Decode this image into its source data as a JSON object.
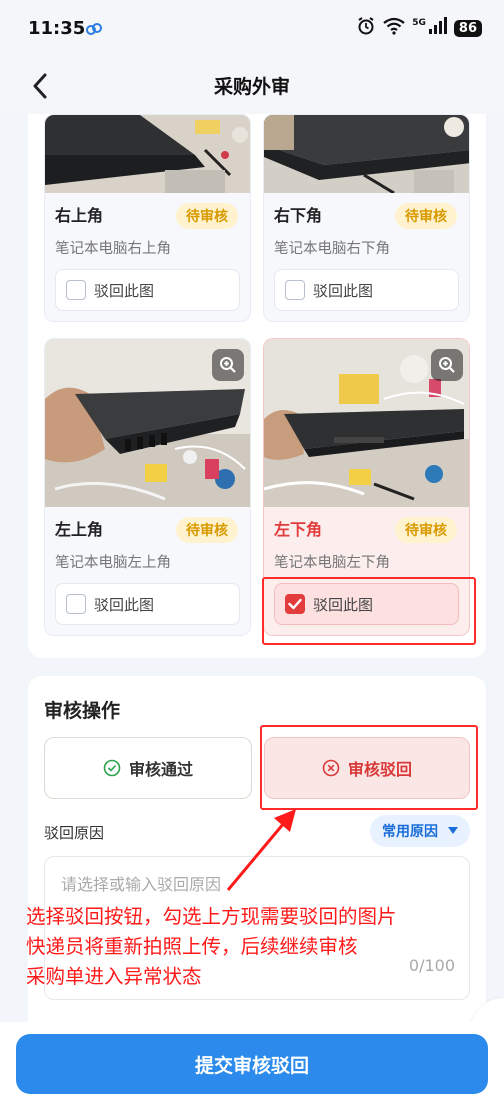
{
  "status_bar": {
    "time": "11:35",
    "signal_label": "5G",
    "battery": "86"
  },
  "nav": {
    "title": "采购外审"
  },
  "photos": [
    {
      "title": "右上角",
      "badge": "待审核",
      "desc": "笔记本电脑右上角",
      "reject_label": "驳回此图",
      "checked": false
    },
    {
      "title": "右下角",
      "badge": "待审核",
      "desc": "笔记本电脑右下角",
      "reject_label": "驳回此图",
      "checked": false
    },
    {
      "title": "左上角",
      "badge": "待审核",
      "desc": "笔记本电脑左上角",
      "reject_label": "驳回此图",
      "checked": false
    },
    {
      "title": "左下角",
      "badge": "待审核",
      "desc": "笔记本电脑左下角",
      "reject_label": "驳回此图",
      "checked": true
    }
  ],
  "audit": {
    "title": "审核操作",
    "approve_label": "审核通过",
    "reject_label": "审核驳回",
    "reason_label": "驳回原因",
    "common_reason_label": "常用原因",
    "reason_placeholder": "请选择或输入驳回原因",
    "char_count": "0/100"
  },
  "annotation": {
    "line1": "选择驳回按钮，勾选上方现需要驳回的图片",
    "line2": "快递员将重新拍照上传，后续继续审核",
    "line3": "采购单进入异常状态"
  },
  "submit": {
    "label": "提交审核驳回"
  },
  "colors": {
    "primary": "#2b8aeb",
    "danger": "#e23c3c",
    "badge_text": "#d99a00",
    "annotation": "#ff1a1a"
  }
}
